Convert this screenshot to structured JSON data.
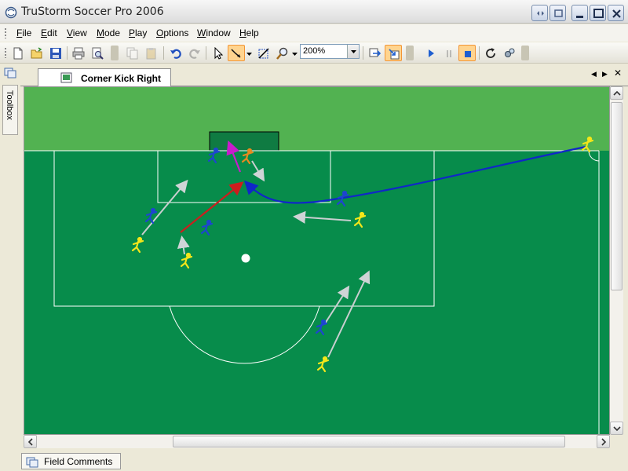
{
  "window": {
    "title": "TruStorm Soccer Pro 2006"
  },
  "menu": [
    {
      "label": "File",
      "accel": "F",
      "rest": "ile"
    },
    {
      "label": "Edit",
      "accel": "E",
      "rest": "dit"
    },
    {
      "label": "View",
      "accel": "V",
      "rest": "iew"
    },
    {
      "label": "Mode",
      "accel": "M",
      "rest": "ode"
    },
    {
      "label": "Play",
      "accel": "P",
      "rest": "lay"
    },
    {
      "label": "Options",
      "accel": "O",
      "rest": "ptions"
    },
    {
      "label": "Window",
      "accel": "W",
      "rest": "indow"
    },
    {
      "label": "Help",
      "accel": "H",
      "rest": "elp"
    }
  ],
  "toolbar": {
    "zoom_value": "200%",
    "icons": [
      "new-file-icon",
      "open-folder-icon",
      "save-icon",
      "print-icon",
      "print-preview-icon",
      "copy-icon",
      "paste-icon",
      "undo-icon",
      "redo-icon",
      "select-arrow-icon",
      "draw-path-icon",
      "transform-icon",
      "zoom-icon",
      "flip-icon",
      "import-icon",
      "play-icon",
      "pause-icon",
      "stop-icon",
      "refresh-icon",
      "settings-icon"
    ]
  },
  "sidebar": {
    "toolbox_label": "Toolbox"
  },
  "document": {
    "active_tab": "Corner Kick Right"
  },
  "field": {
    "colors": {
      "outfield": "#52b251",
      "pitch": "#078c4b",
      "goal": "#0f7b42",
      "team_blue": "#1e45d0",
      "team_yellow": "#f3e61a",
      "orange_player": "#e88a20",
      "ball_path": "#1027c8",
      "pass_arrow": "#c81d1d",
      "shot_arrow": "#c41ccc",
      "run_arrow": "#c9cfd0"
    },
    "players": {
      "blue_count": 5,
      "yellow_count": 5,
      "orange_count": 1
    }
  },
  "bottom": {
    "tab_label": "Field Comments"
  }
}
